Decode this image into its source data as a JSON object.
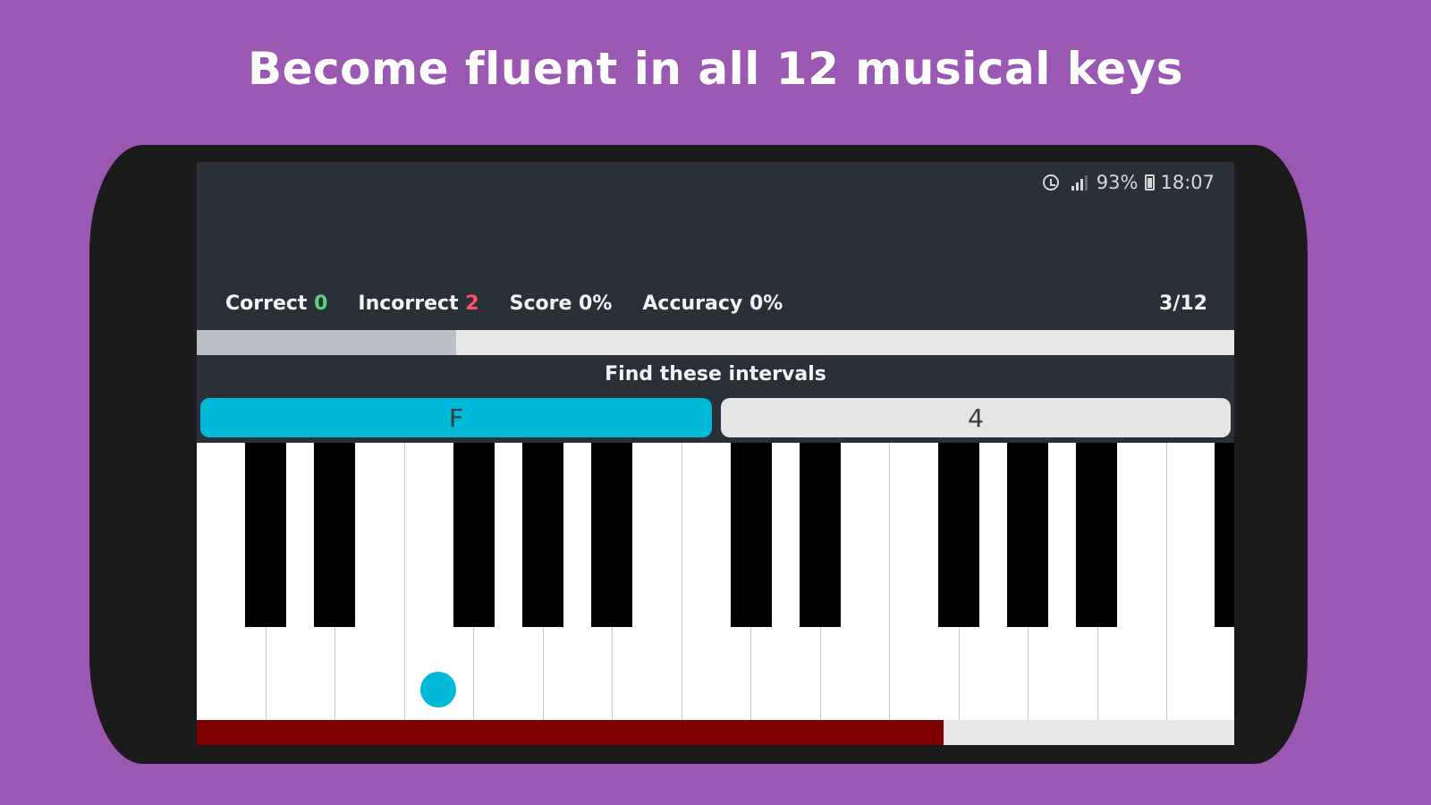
{
  "banner": {
    "title": "Become fluent in all 12 musical keys"
  },
  "status_bar": {
    "icons": [
      "alarm-icon",
      "signal-icon",
      "battery-icon"
    ],
    "battery_percent": "93%",
    "time": "18:07"
  },
  "stats": {
    "correct_label": "Correct",
    "correct_value": "0",
    "incorrect_label": "Incorrect",
    "incorrect_value": "2",
    "score_label": "Score",
    "score_value": "0%",
    "accuracy_label": "Accuracy",
    "accuracy_value": "0%",
    "progress_count": "3/12",
    "progress_fraction": 0.25
  },
  "quiz": {
    "prompt": "Find these intervals",
    "note": "F",
    "interval": "4"
  },
  "timer": {
    "remaining_fraction": 0.72
  },
  "colors": {
    "background": "#9a58b2",
    "accent": "#00b8d8",
    "correct": "#5fd07a",
    "incorrect": "#ff4f6d",
    "timer": "#7f0000"
  }
}
